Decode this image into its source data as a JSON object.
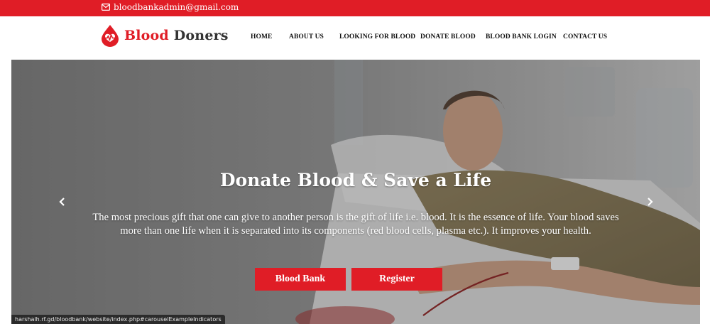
{
  "topbar": {
    "email": "bloodbankadmin@gmail.com",
    "email_icon": "envelope-icon"
  },
  "navbar": {
    "brand_part1": "Blood",
    "brand_part2": "Doners",
    "logo_icon": "blood-drop-heartbeat-icon",
    "links": [
      {
        "label": "HOME"
      },
      {
        "label": "ABOUT US"
      },
      {
        "label": "LOOKING FOR BLOOD"
      },
      {
        "label": "DONATE BLOOD"
      },
      {
        "label": "BLOOD BANK LOGIN"
      },
      {
        "label": "CONTACT US"
      }
    ]
  },
  "hero": {
    "title": "Donate Blood & Save a Life",
    "description": "The most precious gift that one can give to another person is the gift of life i.e. blood. It is the essence of life. Your blood saves more than one life when it is separated into its components (red blood cells, plasma etc.). It improves your health.",
    "primary_button": "Blood Bank",
    "secondary_button": "Register",
    "prev_icon": "chevron-left-icon",
    "next_icon": "chevron-right-icon"
  },
  "status_bar": {
    "url": "harshalh.rf.gd/bloodbank/website/index.php#carouselExampleIndicators"
  },
  "colors": {
    "brand_red": "#e01d26",
    "dark_text": "#333333",
    "status_bar_bg": "#2b2b2b"
  }
}
